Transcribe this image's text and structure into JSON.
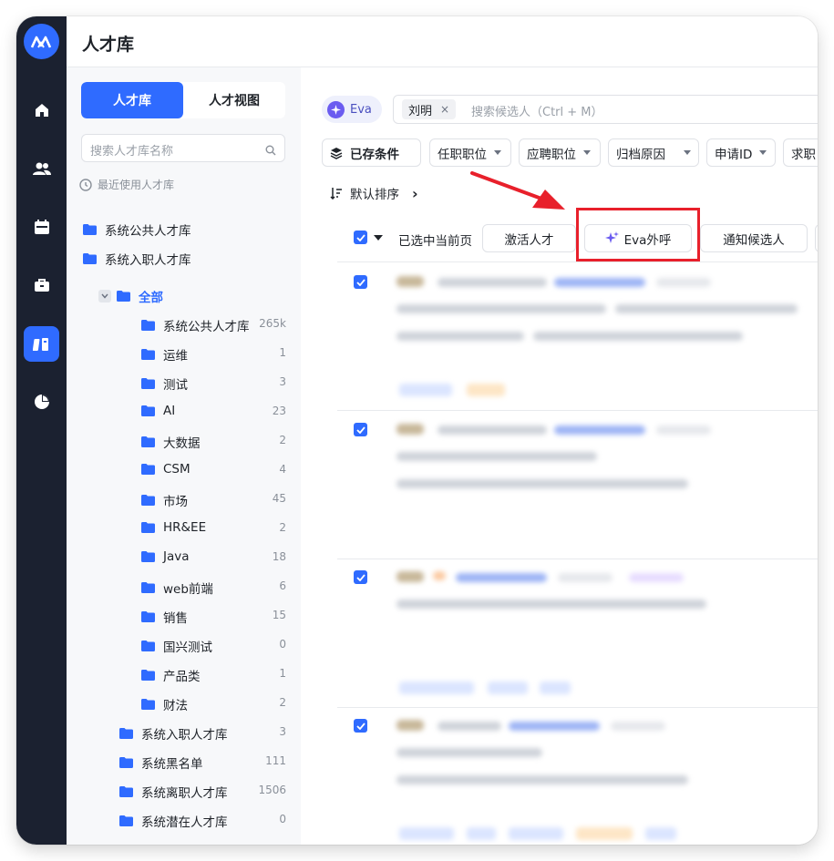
{
  "app": {
    "title": "人才库"
  },
  "rail": {
    "items": [
      "home",
      "candidates",
      "calendar",
      "briefcase",
      "talent-library",
      "reports"
    ],
    "active": "talent-library"
  },
  "sidebar": {
    "tabs": [
      {
        "label": "人才库",
        "active": true
      },
      {
        "label": "人才视图",
        "active": false
      }
    ],
    "search_placeholder": "搜索人才库名称",
    "recent_label": "最近使用人才库",
    "recent_items": [
      "系统公共人才库",
      "系统入职人才库"
    ],
    "root_label": "全部",
    "children": [
      {
        "label": "系统公共人才库",
        "count": "265k"
      },
      {
        "label": "运维",
        "count": "1"
      },
      {
        "label": "测试",
        "count": "3"
      },
      {
        "label": "AI",
        "count": "23"
      },
      {
        "label": "大数据",
        "count": "2"
      },
      {
        "label": "CSM",
        "count": "4"
      },
      {
        "label": "市场",
        "count": "45"
      },
      {
        "label": "HR&EE",
        "count": "2"
      },
      {
        "label": "Java",
        "count": "18"
      },
      {
        "label": "web前端",
        "count": "6"
      },
      {
        "label": "销售",
        "count": "15"
      },
      {
        "label": "国兴测试",
        "count": "0"
      },
      {
        "label": "产品类",
        "count": "1"
      },
      {
        "label": "财法",
        "count": "2"
      }
    ],
    "system_items": [
      {
        "label": "系统入职人才库",
        "count": "3"
      },
      {
        "label": "系统黑名单",
        "count": "111"
      },
      {
        "label": "系统离职人才库",
        "count": "1506"
      },
      {
        "label": "系统潜在人才库",
        "count": "0"
      }
    ]
  },
  "search": {
    "eva_label": "Eva",
    "chip": "刘明",
    "chip_close": "×",
    "placeholder": "搜索候选人（Ctrl + M）"
  },
  "filters": {
    "saved": "已存条件",
    "items": [
      "任职职位",
      "应聘职位",
      "归档原因",
      "申请ID",
      "求职"
    ]
  },
  "sort": {
    "label": "默认排序",
    "arrow": "›"
  },
  "selection": {
    "label": "已选中当前页",
    "actions": [
      "激活人才",
      "Eva外呼",
      "通知候选人"
    ]
  },
  "colors": {
    "accent": "#2f6bff",
    "rail": "#1b2130",
    "highlight": "#e8202b",
    "eva": "#6b5cf0"
  }
}
